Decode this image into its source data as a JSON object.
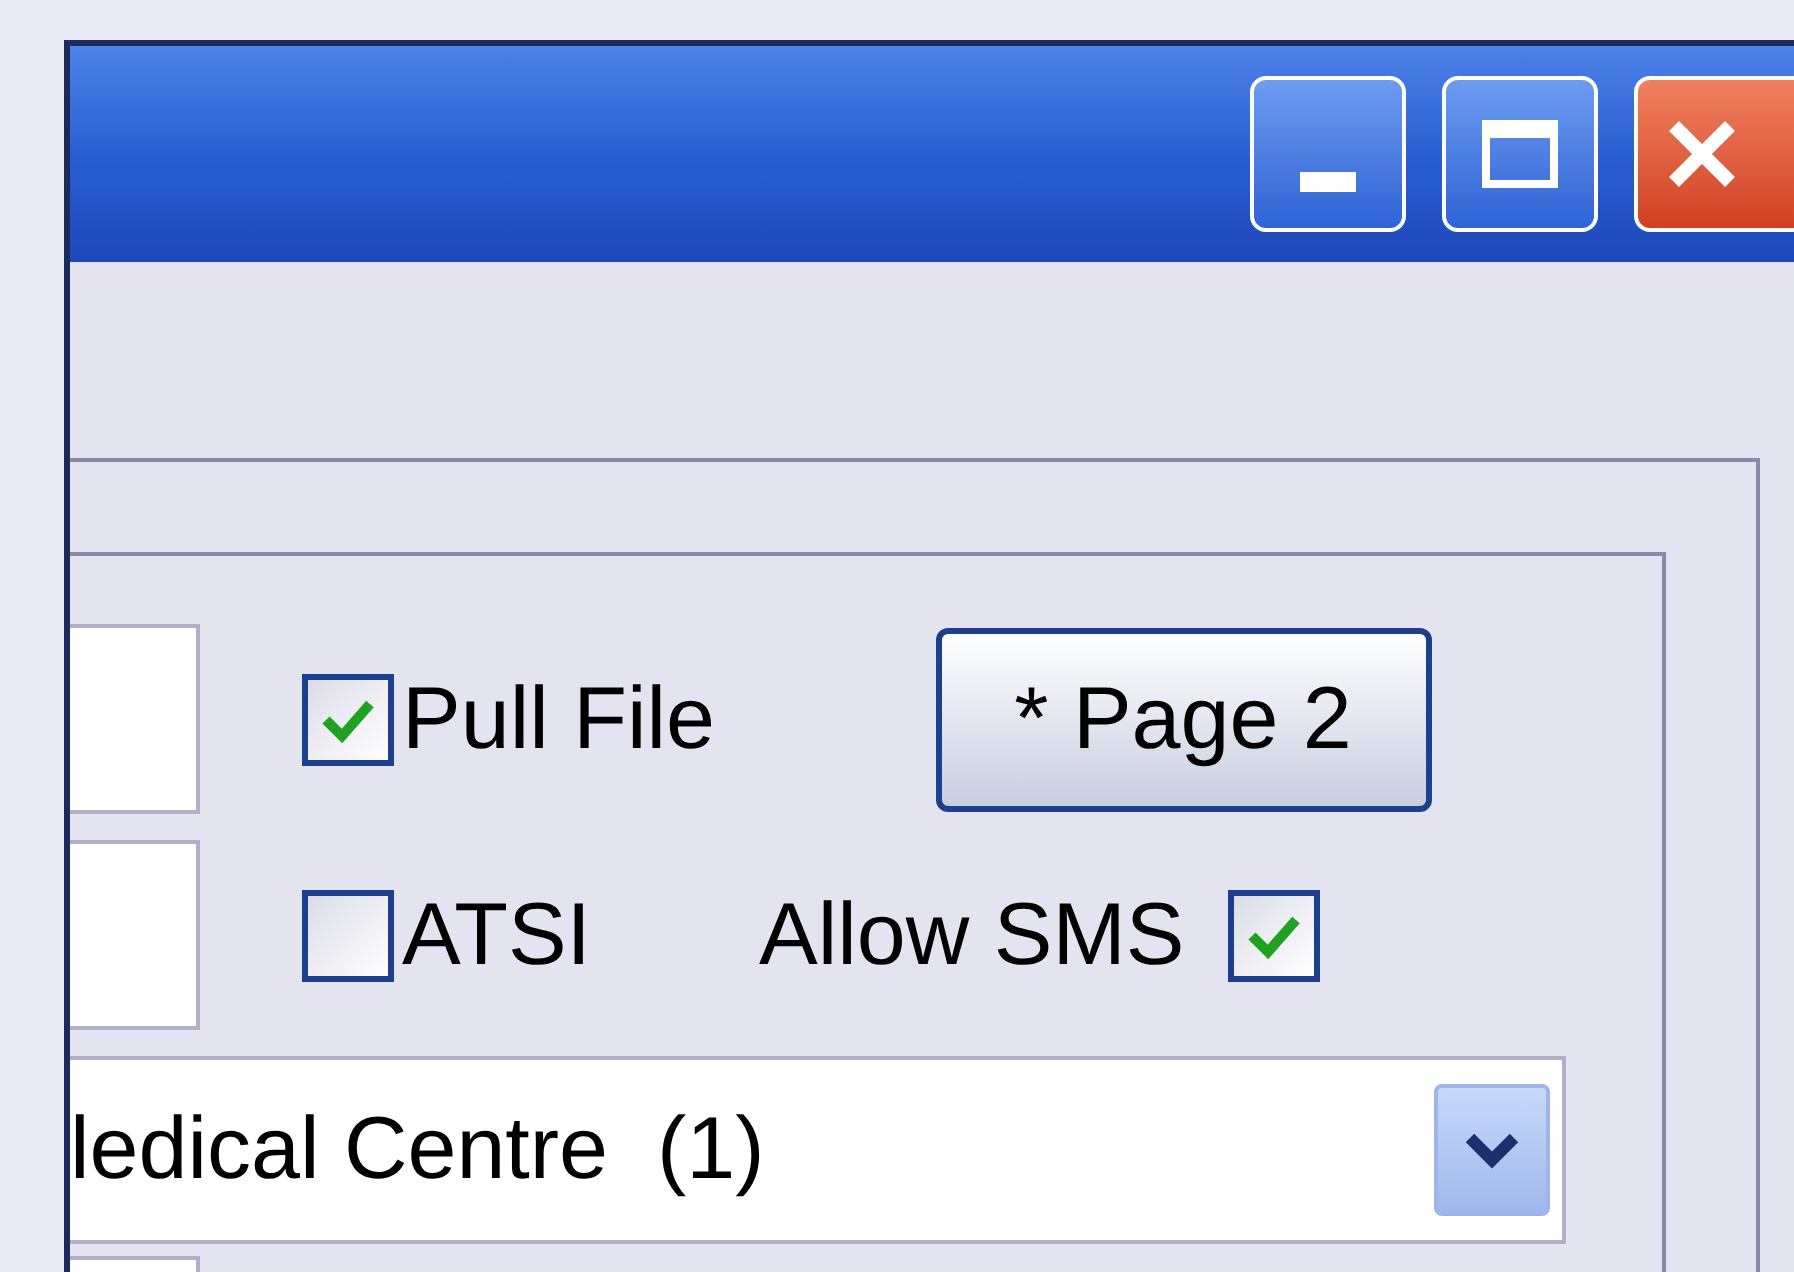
{
  "checkboxes": [
    {
      "label": "Pull File",
      "checked": true
    },
    {
      "label": "ATSI",
      "checked": false
    },
    {
      "label": "Allow SMS",
      "checked": true
    }
  ],
  "page_button": {
    "label": "* Page 2"
  },
  "dropdown": {
    "value": "ledical Centre  (1)"
  }
}
